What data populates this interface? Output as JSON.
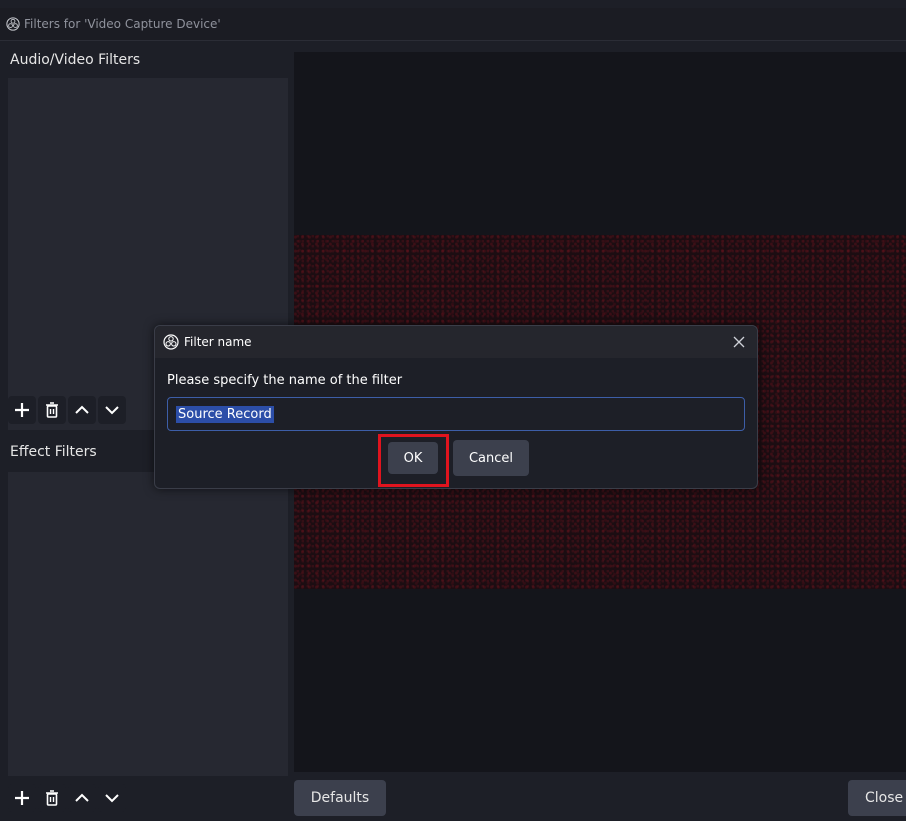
{
  "window": {
    "title": "Filters for 'Video Capture Device'"
  },
  "left_panel": {
    "audio_video_label": "Audio/Video Filters",
    "effect_filters_label": "Effect Filters",
    "toolbar_icons": [
      "plus-icon",
      "trash-icon",
      "chevron-up-icon",
      "chevron-down-icon"
    ]
  },
  "bottom_bar": {
    "defaults_label": "Defaults",
    "close_label": "Close"
  },
  "dialog": {
    "title": "Filter name",
    "prompt": "Please specify the name of the filter",
    "input_value": "Source Record",
    "ok_label": "OK",
    "cancel_label": "Cancel"
  },
  "colors": {
    "background": "#1d1f27",
    "panel": "#262831",
    "button": "#3c404d",
    "selection": "#2c4ea8",
    "highlight_box": "#e0141e"
  }
}
